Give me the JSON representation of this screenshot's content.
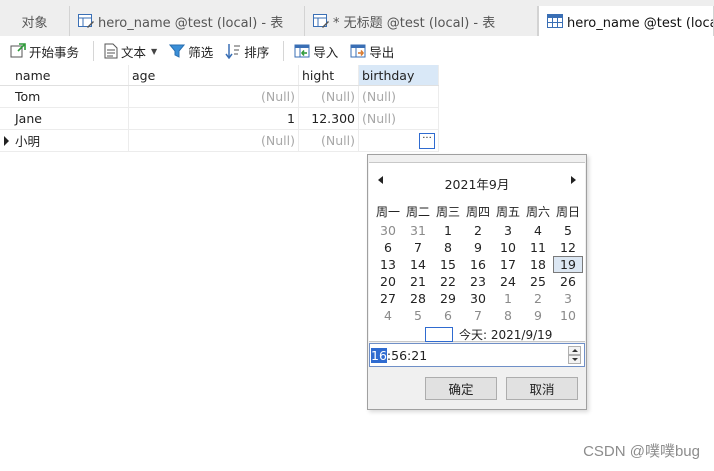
{
  "tabs": [
    {
      "label": "对象",
      "icon": "none"
    },
    {
      "label": "hero_name @test (local) - 表",
      "icon": "table-edit-icon"
    },
    {
      "label": "* 无标题 @test (local) - 表",
      "icon": "table-edit-icon"
    },
    {
      "label": "hero_name @test (local) - 表",
      "icon": "table-icon"
    }
  ],
  "toolbar": {
    "begin_transaction": "开始事务",
    "text": "文本",
    "filter": "筛选",
    "sort": "排序",
    "import": "导入",
    "export": "导出"
  },
  "grid": {
    "columns": [
      "name",
      "age",
      "hight",
      "birthday"
    ],
    "rows": [
      {
        "name": "Tom",
        "age": "(Null)",
        "hight": "(Null)",
        "birthday": "(Null)"
      },
      {
        "name": "Jane",
        "age": "1",
        "hight": "12.300",
        "birthday": "(Null)"
      },
      {
        "name": "小明",
        "age": "(Null)",
        "hight": "(Null)",
        "birthday": ""
      }
    ],
    "ellipsis": "···"
  },
  "calendar": {
    "title": "2021年9月",
    "weekdays": [
      "周一",
      "周二",
      "周三",
      "周四",
      "周五",
      "周六",
      "周日"
    ],
    "days": [
      {
        "d": "30",
        "o": true
      },
      {
        "d": "31",
        "o": true
      },
      {
        "d": "1"
      },
      {
        "d": "2"
      },
      {
        "d": "3"
      },
      {
        "d": "4"
      },
      {
        "d": "5"
      },
      {
        "d": "6"
      },
      {
        "d": "7"
      },
      {
        "d": "8"
      },
      {
        "d": "9"
      },
      {
        "d": "10"
      },
      {
        "d": "11"
      },
      {
        "d": "12"
      },
      {
        "d": "13"
      },
      {
        "d": "14"
      },
      {
        "d": "15"
      },
      {
        "d": "16"
      },
      {
        "d": "17"
      },
      {
        "d": "18"
      },
      {
        "d": "19",
        "t": true
      },
      {
        "d": "20"
      },
      {
        "d": "21"
      },
      {
        "d": "22"
      },
      {
        "d": "23"
      },
      {
        "d": "24"
      },
      {
        "d": "25"
      },
      {
        "d": "26"
      },
      {
        "d": "27"
      },
      {
        "d": "28"
      },
      {
        "d": "29"
      },
      {
        "d": "30"
      },
      {
        "d": "1",
        "o": true
      },
      {
        "d": "2",
        "o": true
      },
      {
        "d": "3",
        "o": true
      },
      {
        "d": "4",
        "o": true
      },
      {
        "d": "5",
        "o": true
      },
      {
        "d": "6",
        "o": true
      },
      {
        "d": "7",
        "o": true
      },
      {
        "d": "8",
        "o": true
      },
      {
        "d": "9",
        "o": true
      },
      {
        "d": "10",
        "o": true
      }
    ],
    "today_label": "今天: 2021/9/19",
    "time_hour": "16",
    "time_rest": ":56:21",
    "ok_label": "确定",
    "cancel_label": "取消"
  },
  "watermark": "CSDN @噗噗bug",
  "colors": {
    "accent": "#2f6bd0",
    "header_selected": "#d9e8f7",
    "null_text": "#a8a8a8"
  }
}
